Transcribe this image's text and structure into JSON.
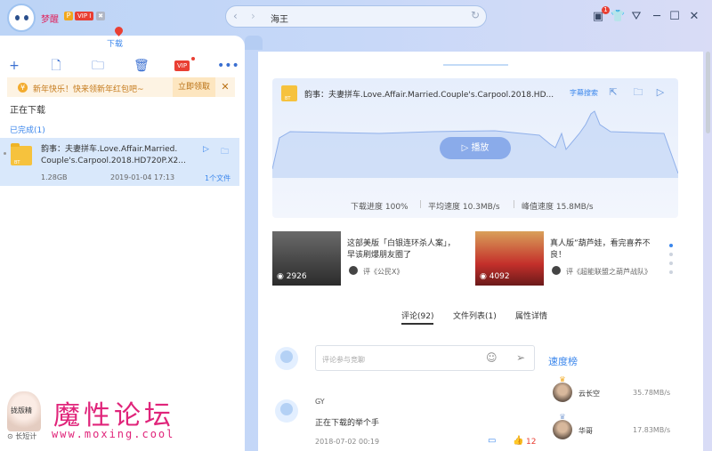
{
  "app": {
    "username": "梦醒",
    "badges": {
      "p": "P",
      "vip": "VIP I",
      "extra": "✖"
    }
  },
  "search": {
    "value": "海王"
  },
  "titlebar": {
    "notify_count": "1"
  },
  "left": {
    "tab_label": "下载",
    "toolbar": {
      "vip_label": "VIP"
    },
    "banner": {
      "text": "新年快乐！快来领新年红包吧~",
      "button": "立即领取",
      "close": "✕"
    },
    "section_downloading": "正在下载",
    "section_done": "已完成(1)",
    "task": {
      "name": "韵事：夫妻拼车.Love.Affair.Married.Couple's.Carpool.2018.HD720P.X2...",
      "name_line1": "韵事：夫妻拼车.Love.Affair.Married.",
      "name_line2": "Couple's.Carpool.2018.HD720P.X2...",
      "size": "1.28GB",
      "date": "2019-01-04 17:13",
      "files": "1个文件",
      "badge": "BT"
    },
    "speed_label": "长短计",
    "footer_left": "长短计",
    "speed_tag": "拢版精"
  },
  "watermark": {
    "cn": "魔性论坛",
    "url": "www.moxing.cool"
  },
  "main": {
    "card": {
      "title": "韵事：夫妻拼车.Love.Affair.Married.Couple's.Carpool.2018.HD...",
      "subtitle_search": "字幕搜索",
      "badge": "BT",
      "play_label": "播放",
      "stats": [
        "下载进度 100%",
        "平均速度 10.3MB/s",
        "峰值速度 15.8MB/s"
      ]
    },
    "recs": [
      {
        "title": "这部美版「白银连环杀人案」，早该刷爆朋友圈了",
        "source": "评《公民X》",
        "views": "2926"
      },
      {
        "title": "真人版”葫芦娃，看完喜养不良！",
        "source": "评《超能联盟之葫芦战队》",
        "views": "4092"
      }
    ],
    "tabs": [
      "评论(92)",
      "文件列表(1)",
      "属性详情"
    ],
    "comment_placeholder": "评论参与竞聊",
    "comment": {
      "user": "GY",
      "text": "正在下载的举个手",
      "date": "2018-07-02 00:19",
      "likes": "12"
    },
    "rank": {
      "title": "速度榜",
      "items": [
        {
          "name": "云长空",
          "speed": "35.78MB/s"
        },
        {
          "name": "华哥",
          "speed": "17.83MB/s"
        }
      ]
    }
  },
  "colors": {
    "accent": "#3a86ec",
    "danger": "#e93f33",
    "gold": "#f6c23d"
  }
}
